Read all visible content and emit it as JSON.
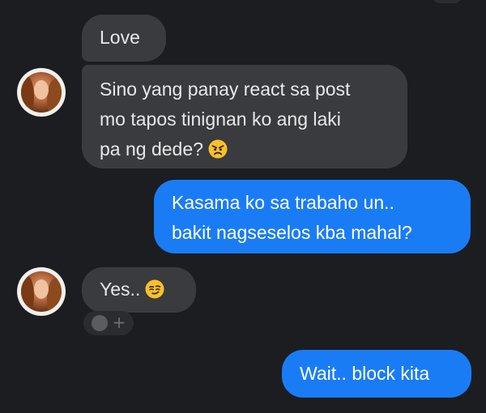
{
  "messages": [
    {
      "sender": "contact",
      "lines": [
        "Love"
      ]
    },
    {
      "sender": "contact",
      "lines": [
        "Sino yang panay react sa post",
        "mo tapos tinignan ko ang laki",
        "pa ng dede?"
      ],
      "emoji": "angry-face"
    },
    {
      "sender": "me",
      "lines": [
        "Kasama ko sa trabaho un..",
        "bakit nagseselos kba mahal?"
      ]
    },
    {
      "sender": "contact",
      "lines": [
        "Yes.."
      ],
      "emoji": "smirking-face"
    },
    {
      "sender": "me",
      "lines": [
        "Wait.. block kita"
      ]
    }
  ],
  "colors": {
    "background": "#1c1d20",
    "incoming_bubble": "#3a3b3e",
    "outgoing_bubble": "#1a7cf5",
    "text": "#e8e8ea"
  },
  "icons": {
    "reaction_add": "add-reaction-icon"
  }
}
